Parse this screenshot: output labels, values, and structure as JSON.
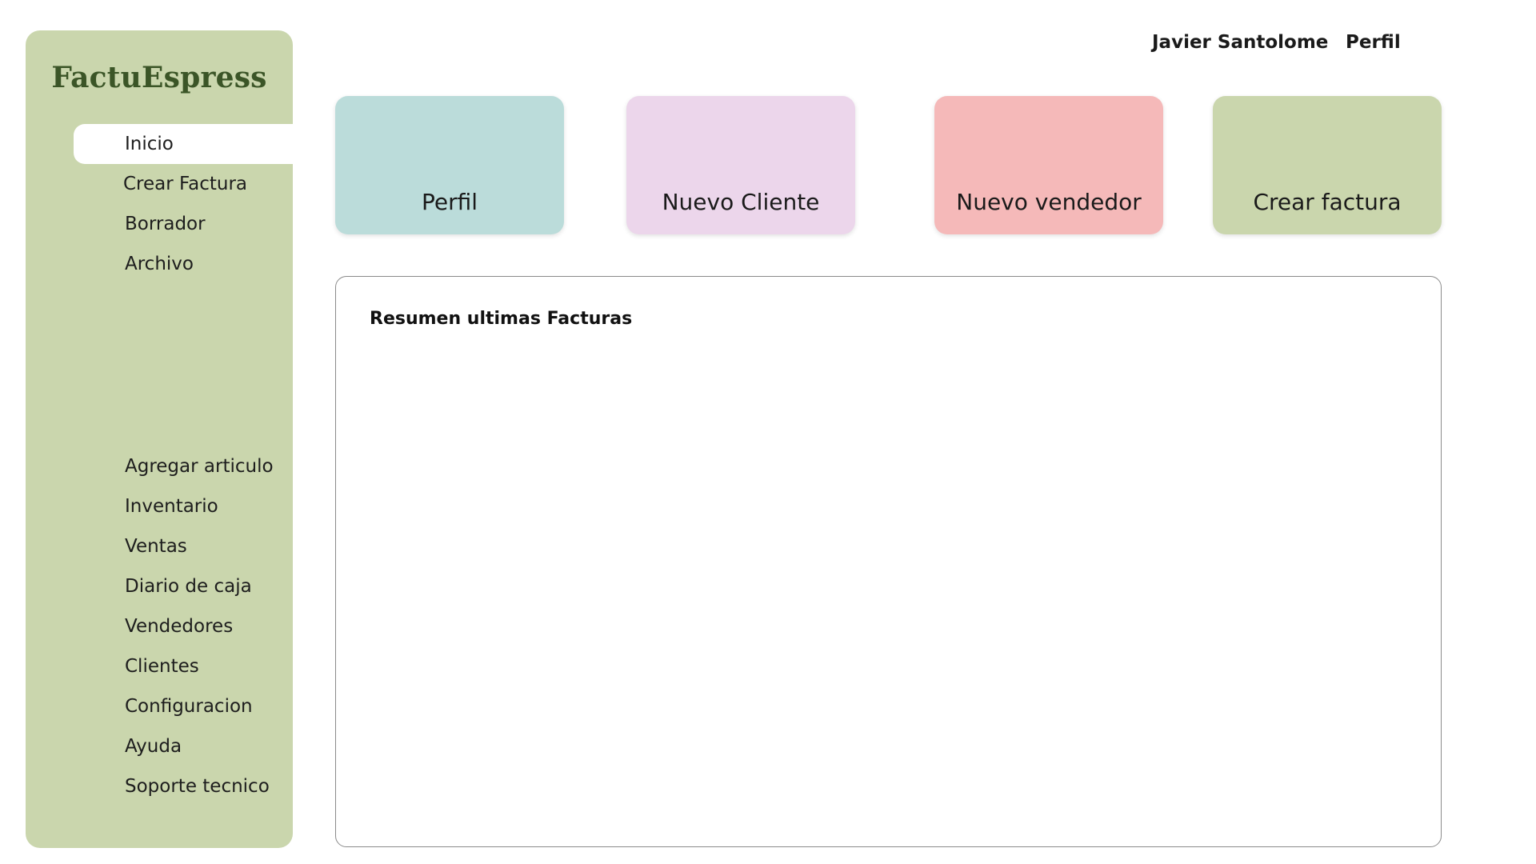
{
  "app": {
    "brand": "FactuEspress"
  },
  "header": {
    "user_name": "Javier Santolome",
    "profile_link": "Perfil"
  },
  "sidebar": {
    "items": [
      {
        "label": "Inicio",
        "active": true
      },
      {
        "label": "Crear Factura"
      },
      {
        "label": "Borrador"
      },
      {
        "label": "Archivo"
      },
      {
        "label": "Agregar articulo"
      },
      {
        "label": "Inventario"
      },
      {
        "label": "Ventas"
      },
      {
        "label": "Diario de caja"
      },
      {
        "label": "Vendedores"
      },
      {
        "label": "Clientes"
      },
      {
        "label": "Configuracion"
      },
      {
        "label": "Ayuda"
      },
      {
        "label": "Soporte tecnico"
      }
    ]
  },
  "cards": [
    {
      "label": "Perfil",
      "color": "#bbdcda"
    },
    {
      "label": "Nuevo Cliente",
      "color": "#ecd6eb"
    },
    {
      "label": "Nuevo vendedor",
      "color": "#f5b9b9"
    },
    {
      "label": "Crear factura",
      "color": "#cad6ad"
    }
  ],
  "summary": {
    "title": "Resumen ultimas Facturas"
  },
  "colors": {
    "sidebar": "#cad6ad",
    "brand": "#3b5527"
  }
}
